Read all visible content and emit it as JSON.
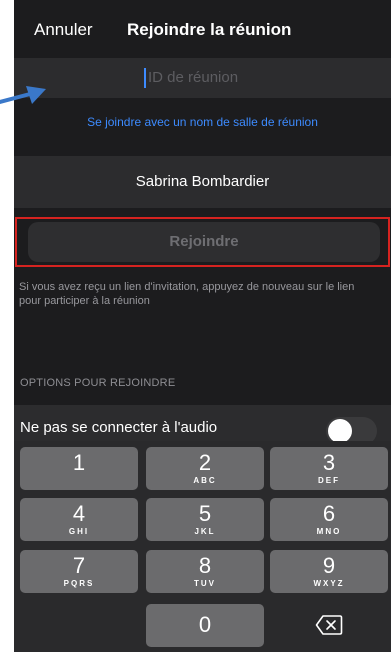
{
  "header": {
    "cancel_label": "Annuler",
    "title": "Rejoindre la réunion"
  },
  "meeting_id": {
    "value": "",
    "placeholder": "ID de réunion"
  },
  "room_link_label": "Se joindre avec un nom de salle de réunion",
  "display_name": "Sabrina Bombardier",
  "join_button_label": "Rejoindre",
  "helper_text": "Si vous avez reçu un lien d'invitation, appuyez de nouveau sur le lien pour participer à la réunion",
  "options": {
    "header": "OPTIONS POUR REJOINDRE",
    "audio_label": "Ne pas se connecter à l'audio",
    "audio_toggle_on": false
  },
  "keypad": {
    "rows": [
      [
        {
          "digit": "1",
          "letters": ""
        },
        {
          "digit": "2",
          "letters": "ABC"
        },
        {
          "digit": "3",
          "letters": "DEF"
        }
      ],
      [
        {
          "digit": "4",
          "letters": "GHI"
        },
        {
          "digit": "5",
          "letters": "JKL"
        },
        {
          "digit": "6",
          "letters": "MNO"
        }
      ],
      [
        {
          "digit": "7",
          "letters": "PQRS"
        },
        {
          "digit": "8",
          "letters": "TUV"
        },
        {
          "digit": "9",
          "letters": "WXYZ"
        }
      ],
      [
        {
          "digit": "0",
          "letters": ""
        }
      ]
    ],
    "delete_icon": "backspace-icon"
  },
  "colors": {
    "background": "#1c1c1e",
    "field": "#2c2c2e",
    "accent": "#3d8bff",
    "highlight": "#d62320",
    "annotation_arrow": "#3a78c9"
  }
}
